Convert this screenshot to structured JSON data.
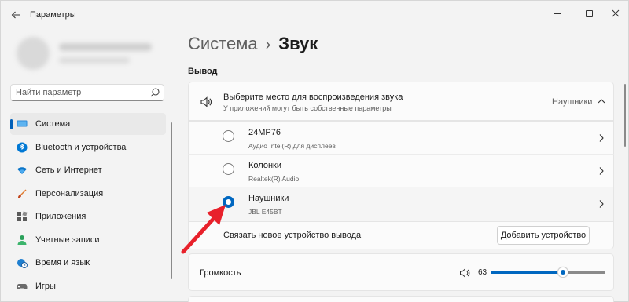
{
  "window": {
    "title": "Параметры"
  },
  "search": {
    "placeholder": "Найти параметр"
  },
  "sidebar": {
    "items": [
      {
        "label": "Система",
        "icon": "monitor-icon",
        "active": true
      },
      {
        "label": "Bluetooth и устройства",
        "icon": "bluetooth-icon"
      },
      {
        "label": "Сеть и Интернет",
        "icon": "wifi-icon"
      },
      {
        "label": "Персонализация",
        "icon": "brush-icon"
      },
      {
        "label": "Приложения",
        "icon": "apps-icon"
      },
      {
        "label": "Учетные записи",
        "icon": "person-icon"
      },
      {
        "label": "Время и язык",
        "icon": "globe-clock-icon"
      },
      {
        "label": "Игры",
        "icon": "gamepad-icon"
      }
    ]
  },
  "breadcrumb": {
    "parent": "Система",
    "separator": "›",
    "current": "Звук"
  },
  "output": {
    "section_title": "Вывод",
    "title": "Выберите место для воспроизведения звука",
    "subtitle": "У приложений могут быть собственные параметры",
    "selected": "Наушники",
    "devices": [
      {
        "name": "24MP76",
        "detail": "Аудио Intel(R) для дисплеев",
        "checked": false
      },
      {
        "name": "Колонки",
        "detail": "Realtek(R) Audio",
        "checked": false
      },
      {
        "name": "Наушники",
        "detail": "JBL E45BT",
        "checked": true
      }
    ],
    "pair_label": "Связать новое устройство вывода",
    "add_button": "Добавить устройство"
  },
  "volume": {
    "label": "Громкость",
    "value": "63",
    "level": 63
  },
  "colors": {
    "accent": "#0067c0",
    "annotation_arrow": "#e8212b"
  }
}
